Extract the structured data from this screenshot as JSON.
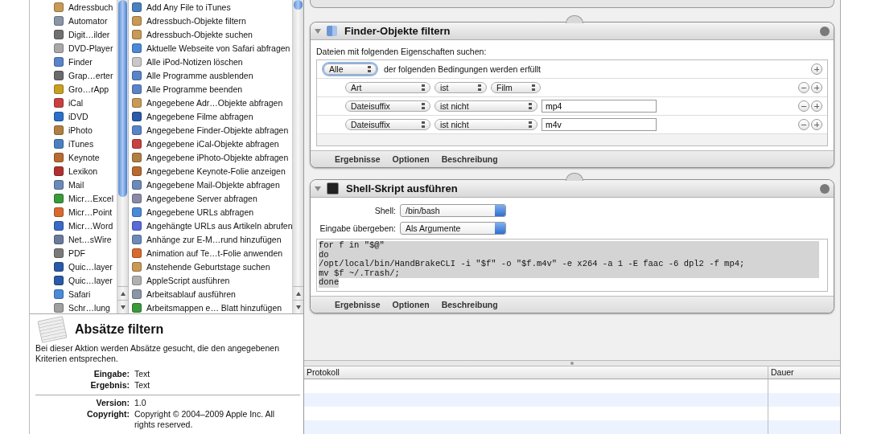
{
  "library": {
    "apps": [
      {
        "label": "Adressbuch",
        "color": "#c89a55"
      },
      {
        "label": "Automator",
        "color": "#8a96a8"
      },
      {
        "label": "Digit…ilder",
        "color": "#707070"
      },
      {
        "label": "DVD-Player",
        "color": "#a8a8a8"
      },
      {
        "label": "Finder",
        "color": "#5a84c8"
      },
      {
        "label": "Grap…erter",
        "color": "#6a6a6a"
      },
      {
        "label": "Gro…rApp",
        "color": "#c8a020"
      },
      {
        "label": "iCal",
        "color": "#c84040"
      },
      {
        "label": "iDVD",
        "color": "#2a70c8"
      },
      {
        "label": "iPhoto",
        "color": "#b08040"
      },
      {
        "label": "iTunes",
        "color": "#4a80c0"
      },
      {
        "label": "Keynote",
        "color": "#b86a30"
      },
      {
        "label": "Lexikon",
        "color": "#b03030"
      },
      {
        "label": "Mail",
        "color": "#6a8ab8"
      },
      {
        "label": "Micr…Excel",
        "color": "#3a9a3a"
      },
      {
        "label": "Micr…Point",
        "color": "#d86a30"
      },
      {
        "label": "Micr…Word",
        "color": "#3a6ac8"
      },
      {
        "label": "Net…sWire",
        "color": "#6a7a9a"
      },
      {
        "label": "PDF",
        "color": "#7a7a7a"
      },
      {
        "label": "Quic…layer",
        "color": "#2a5aa8"
      },
      {
        "label": "Quic…layer",
        "color": "#2a5aa8"
      },
      {
        "label": "Safari",
        "color": "#4a8ad8"
      },
      {
        "label": "Schr…lung",
        "color": "#a0a0a0"
      }
    ],
    "actions": [
      {
        "label": "Add Any File to iTunes",
        "color": "#4a80c0"
      },
      {
        "label": "Adressbuch-Objekte filtern",
        "color": "#c89a55"
      },
      {
        "label": "Adressbuch-Objekte suchen",
        "color": "#c89a55"
      },
      {
        "label": "Aktuelle Webseite von Safari abfragen",
        "color": "#4a8ad8"
      },
      {
        "label": "Alle iPod-Notizen löschen",
        "color": "#c8c8c8"
      },
      {
        "label": "Alle Programme ausblenden",
        "color": "#5a84c8"
      },
      {
        "label": "Alle Programme beenden",
        "color": "#5a84c8"
      },
      {
        "label": "Angegebene Adr…Objekte abfragen",
        "color": "#c89a55"
      },
      {
        "label": "Angegebene Filme abfragen",
        "color": "#2a5aa8"
      },
      {
        "label": "Angegebene Finder-Objekte abfragen",
        "color": "#5a84c8"
      },
      {
        "label": "Angegebene iCal-Objekte abfragen",
        "color": "#c84040"
      },
      {
        "label": "Angegebene iPhoto-Objekte abfragen",
        "color": "#b08040"
      },
      {
        "label": "Angegebene Keynote-Folie anzeigen",
        "color": "#b86a30"
      },
      {
        "label": "Angegebene Mail-Objekte abfragen",
        "color": "#6a8ab8"
      },
      {
        "label": "Angegebene Server abfragen",
        "color": "#8a8aa8"
      },
      {
        "label": "Angegebene URLs abfragen",
        "color": "#4a8ad8"
      },
      {
        "label": "Angehängte URLs aus Artikeln abrufen",
        "color": "#5a6ad8"
      },
      {
        "label": "Anhänge zur E-M…rund hinzufügen",
        "color": "#6a8ab8"
      },
      {
        "label": "Animation auf Te…t-Folie anwenden",
        "color": "#d86a30"
      },
      {
        "label": "Anstehende Geburtstage suchen",
        "color": "#c89a55"
      },
      {
        "label": "AppleScript ausführen",
        "color": "#b0b0b0"
      },
      {
        "label": "Arbeitsablauf ausführen",
        "color": "#8a96a8"
      },
      {
        "label": "Arbeitsmappen e… Blatt hinzufügen",
        "color": "#3a9a3a"
      }
    ]
  },
  "description": {
    "title": "Absätze filtern",
    "text": "Bei dieser Aktion werden Absätze gesucht, die den angegebenen Kriterien entsprechen.",
    "io": [
      {
        "label": "Eingabe:",
        "value": "Text"
      },
      {
        "label": "Ergebnis:",
        "value": "Text"
      }
    ],
    "meta": [
      {
        "label": "Version:",
        "value": "1.0"
      },
      {
        "label": "Copyright:",
        "value": "Copyright © 2004–2009 Apple Inc.  All rights reserved."
      }
    ]
  },
  "workflow": {
    "actions": [
      {
        "kind": "filter",
        "title": "Finder-Objekte filtern",
        "intro": "Dateien mit folgenden Eigenschaften suchen:",
        "match": {
          "value": "Alle",
          "focused": true,
          "text": "der folgenden Bedingungen werden erfüllt"
        },
        "conditions": [
          {
            "popups": [
              "Art",
              "ist",
              "Film"
            ]
          },
          {
            "popups": [
              "Dateisuffix",
              "ist nicht"
            ],
            "value": "mp4"
          },
          {
            "popups": [
              "Dateisuffix",
              "ist nicht"
            ],
            "value": "m4v"
          }
        ],
        "tabs": [
          "Ergebnisse",
          "Optionen",
          "Beschreibung"
        ]
      },
      {
        "kind": "shell",
        "title": "Shell-Skript ausführen",
        "settings": [
          {
            "label": "Shell:",
            "value": "/bin/bash"
          },
          {
            "label": "Eingabe übergeben:",
            "value": "Als Argumente"
          }
        ],
        "script": {
          "selected": true,
          "lines": [
            "for f in \"$@\"",
            "do",
            "/opt/local/bin/HandBrakeCLI -i \"$f\" -o \"$f.m4v\" -e x264 -a 1 -E faac -6 dpl2 -f mp4;",
            "mv $f ~/.Trash/;",
            "done"
          ]
        },
        "tabs": [
          "Ergebnisse",
          "Optionen",
          "Beschreibung"
        ]
      }
    ]
  },
  "log": {
    "columns": [
      "Protokoll",
      "Dauer"
    ]
  }
}
